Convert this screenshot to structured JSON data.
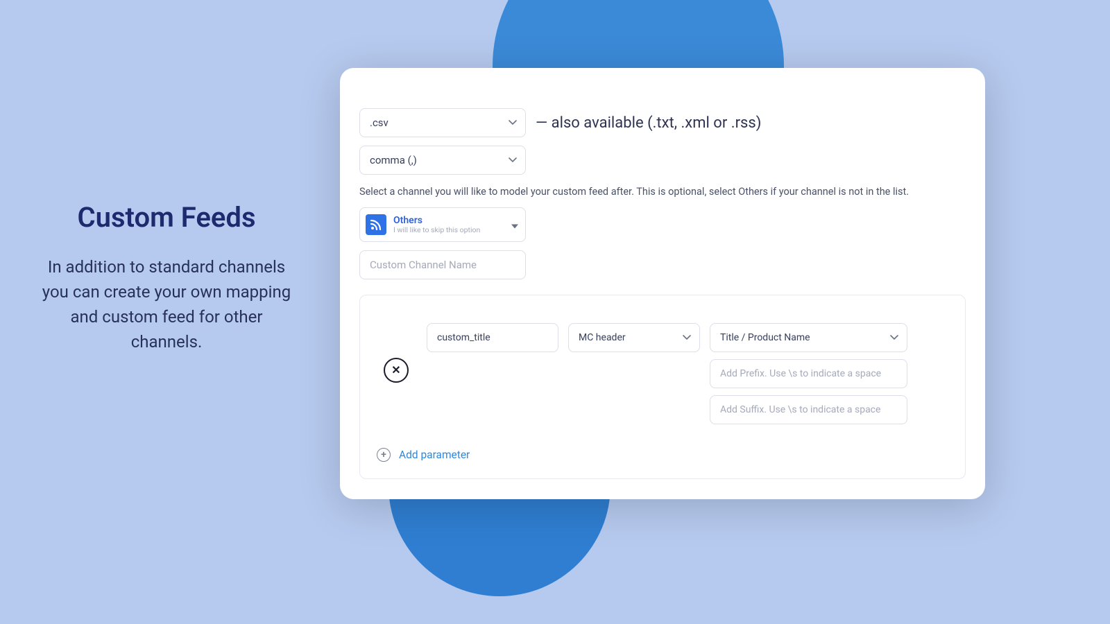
{
  "left": {
    "heading": "Custom Feeds",
    "description": "In addition to standard channels you can create your own mapping and custom feed for other channels."
  },
  "form": {
    "extension": {
      "value": ".csv"
    },
    "extensionHint": "— also available (.txt, .xml or .rss)",
    "delimiter": {
      "value": "comma (,)"
    },
    "instruction": "Select a channel you will like to model your custom feed after. This is optional, select Others if your channel is not in the list.",
    "channel": {
      "title": "Others",
      "subtitle": "I will like to skip this option"
    },
    "channelNamePlaceholder": "Custom Channel Name",
    "mapping": {
      "fieldName": "custom_title",
      "headerSelect": "MC header",
      "sourceSelect": "Title / Product Name",
      "prefixPlaceholder": "Add Prefix. Use \\s to indicate a space",
      "suffixPlaceholder": "Add Suffix. Use \\s to indicate a space"
    },
    "addParameter": "Add parameter"
  }
}
